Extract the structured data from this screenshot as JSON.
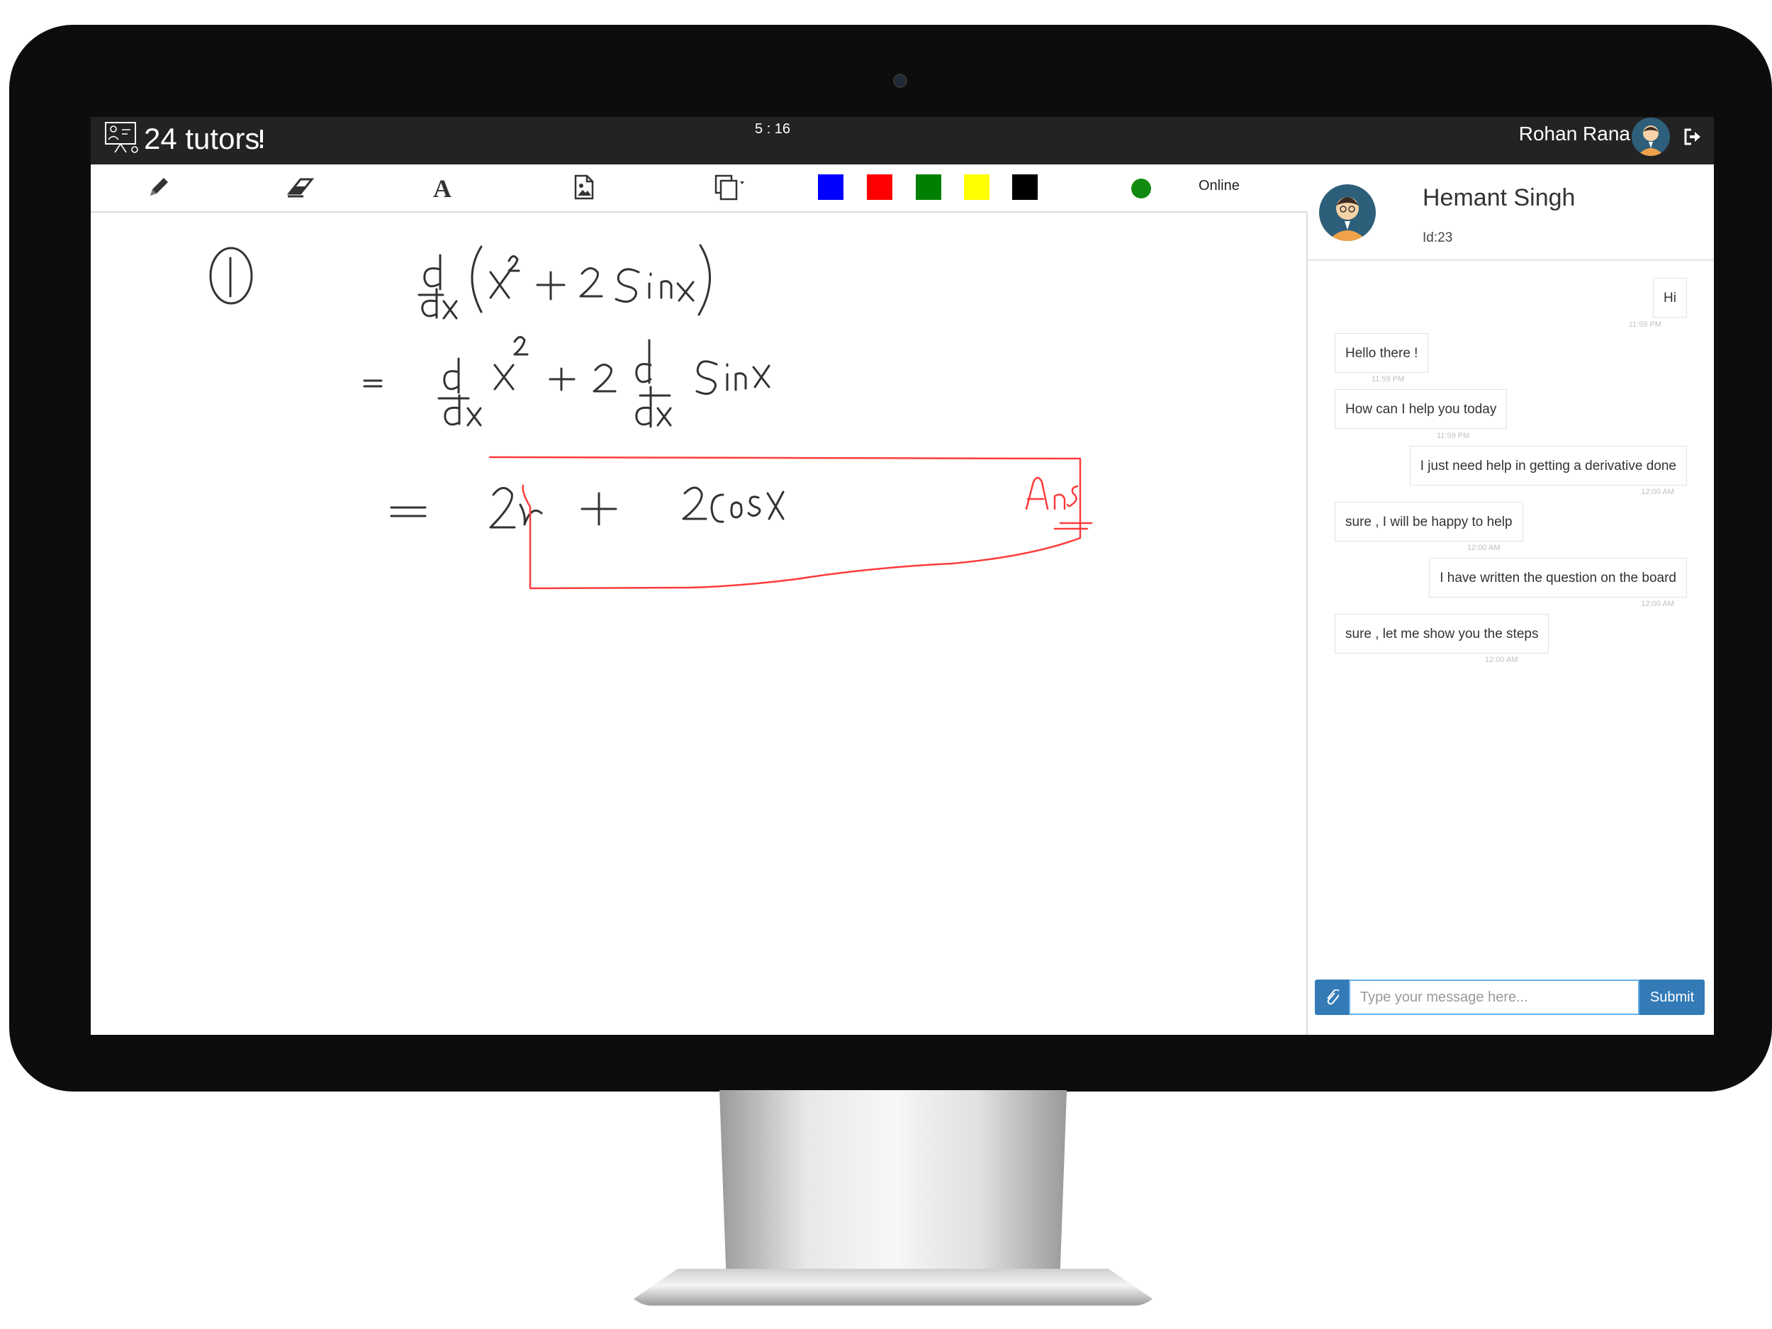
{
  "app": {
    "brand": "24 tutors",
    "timer": "5 : 16",
    "user_name": "Rohan Rana"
  },
  "toolbar": {
    "tools": [
      "pencil-icon",
      "eraser-icon",
      "text-icon",
      "insert-image-icon",
      "copy-pages-icon"
    ],
    "colors": [
      "#0000ff",
      "#ff0000",
      "#008000",
      "#ffff00",
      "#000000"
    ],
    "status_color": "#108a10",
    "status_label": "Online"
  },
  "board": {
    "add_label": "+"
  },
  "chat": {
    "tutor_name": "Hemant Singh",
    "tutor_id": "Id:23",
    "messages": [
      {
        "side": "right",
        "text": "Hi",
        "time": "11:59 PM"
      },
      {
        "side": "left",
        "text": "Hello there !",
        "time": "11:59 PM"
      },
      {
        "side": "left",
        "text": "How can I help you today",
        "time": "11:59 PM"
      },
      {
        "side": "right",
        "text": "I just need help in getting a derivative done",
        "time": "12:00 AM"
      },
      {
        "side": "left",
        "text": "sure , I will be happy to help",
        "time": "12:00 AM"
      },
      {
        "side": "right",
        "text": "I have written the question on the board",
        "time": "12:00 AM"
      },
      {
        "side": "left",
        "text": "sure , let me show you the steps",
        "time": "12:00 AM"
      }
    ],
    "input_placeholder": "Type your message here...",
    "submit_label": "Submit"
  }
}
